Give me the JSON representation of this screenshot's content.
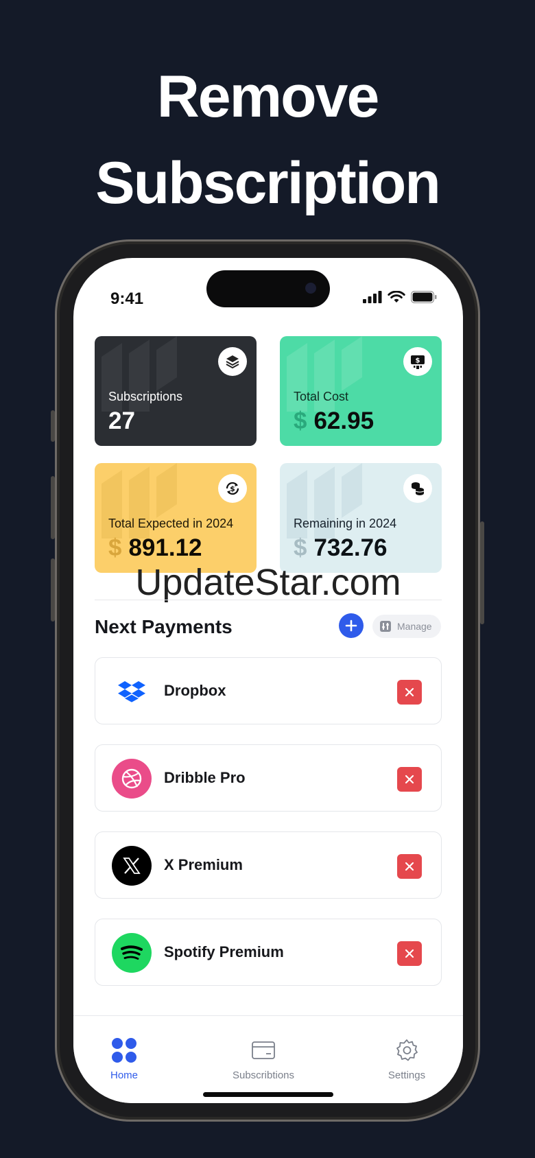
{
  "headline": {
    "line1": "Remove",
    "line2": "Subscription"
  },
  "status_bar": {
    "time": "9:41"
  },
  "summary_cards": [
    {
      "label": "Subscriptions",
      "currency": "",
      "value": "27",
      "icon": "layers-icon",
      "bg": "#2b2e33"
    },
    {
      "label": "Total Cost",
      "currency": "$",
      "value": "62.95",
      "icon": "money-bill-icon",
      "bg": "#4ddba6"
    },
    {
      "label": "Total Expected in 2024",
      "currency": "$",
      "value": "891.12",
      "icon": "dollar-refresh-icon",
      "bg": "#fccf6a"
    },
    {
      "label": "Remaining in 2024",
      "currency": "$",
      "value": "732.76",
      "icon": "coins-stack-icon",
      "bg": "#deeef1"
    }
  ],
  "watermark": "UpdateStar.com",
  "next_payments": {
    "title": "Next Payments",
    "manage_label": "Manage",
    "items": [
      {
        "name": "Dropbox",
        "icon": "dropbox-icon"
      },
      {
        "name": "Dribble Pro",
        "icon": "dribbble-icon"
      },
      {
        "name": "X Premium",
        "icon": "x-logo-icon"
      },
      {
        "name": "Spotify Premium",
        "icon": "spotify-icon"
      }
    ]
  },
  "tabbar": {
    "active": "Home",
    "tabs": [
      {
        "label": "Home",
        "icon": "grid-dots-icon"
      },
      {
        "label": "Subscribtions",
        "icon": "card-icon"
      },
      {
        "label": "Settings",
        "icon": "gear-icon"
      }
    ]
  },
  "colors": {
    "accent": "#2f5bea",
    "delete": "#e5484d",
    "background": "#141a28"
  }
}
